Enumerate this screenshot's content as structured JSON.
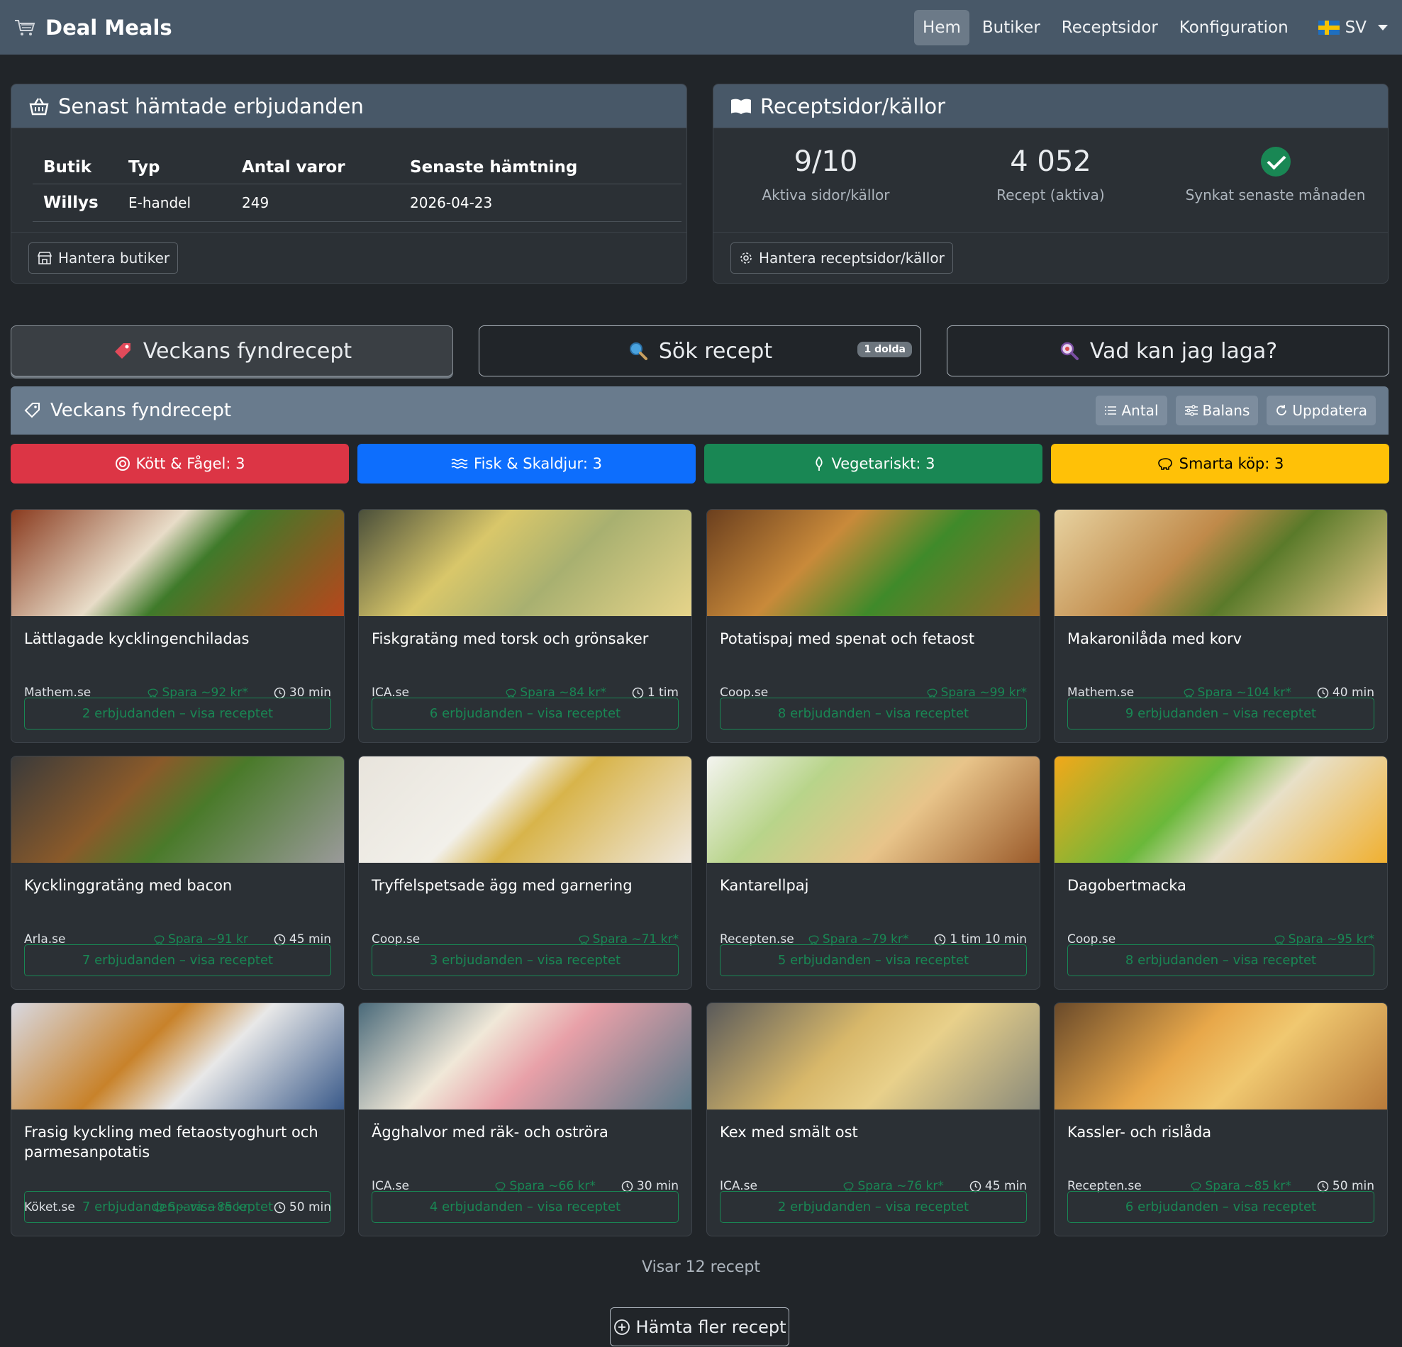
{
  "nav": {
    "brand": "Deal Meals",
    "links": [
      "Hem",
      "Butiker",
      "Receptsidor",
      "Konfiguration"
    ],
    "lang": "SV"
  },
  "offers": {
    "title": "Senast hämtade erbjudanden",
    "headers": [
      "Butik",
      "Typ",
      "Antal varor",
      "Senaste hämtning"
    ],
    "rows": [
      [
        "Willys",
        "E-handel",
        "249",
        "2026-04-23"
      ]
    ],
    "manage": "Hantera butiker"
  },
  "sources": {
    "title": "Receptsidor/källor",
    "active_value": "9/10",
    "active_label": "Aktiva sidor/källor",
    "recipes_value": "4 052",
    "recipes_label": "Recept (aktiva)",
    "sync_label": "Synkat senaste månaden",
    "manage": "Hantera receptsidor/källor"
  },
  "tabs": {
    "deals": "Veckans fyndrecept",
    "search": "Sök recept",
    "search_badge": "1 dolda",
    "cook": "Vad kan jag laga?"
  },
  "deals": {
    "title": "Veckans fyndrecept",
    "btn_count": "Antal",
    "btn_balance": "Balans",
    "btn_update": "Uppdatera"
  },
  "categories": [
    {
      "label": "Kött & Fågel: 3",
      "color": "#dc3545",
      "text": "#ffffff"
    },
    {
      "label": "Fisk & Skaldjur: 3",
      "color": "#0d6efd",
      "text": "#ffffff"
    },
    {
      "label": "Vegetariskt: 3",
      "color": "#198754",
      "text": "#ffffff"
    },
    {
      "label": "Smarta köp: 3",
      "color": "#ffc107",
      "text": "#000000"
    }
  ],
  "recipes": [
    {
      "title": "Lättlagade kycklingenchiladas",
      "source": "Mathem.se",
      "save": "Spara ~92 kr*",
      "time": "30 min",
      "offers": "2 erbjudanden – visa receptet"
    },
    {
      "title": "Fiskgratäng med torsk och grönsaker",
      "source": "ICA.se",
      "save": "Spara ~84 kr*",
      "time": "1 tim",
      "offers": "6 erbjudanden – visa receptet"
    },
    {
      "title": "Potatispaj med spenat och fetaost",
      "source": "Coop.se",
      "save": "Spara ~99 kr*",
      "time": "",
      "offers": "8 erbjudanden – visa receptet"
    },
    {
      "title": "Makaronilåda med korv",
      "source": "Mathem.se",
      "save": "Spara ~104 kr*",
      "time": "40 min",
      "offers": "9 erbjudanden – visa receptet"
    },
    {
      "title": "Kycklinggratäng med bacon",
      "source": "Arla.se",
      "save": "Spara ~91 kr",
      "time": "45 min",
      "offers": "7 erbjudanden – visa receptet"
    },
    {
      "title": "Tryffelspetsade ägg med garnering",
      "source": "Coop.se",
      "save": "Spara ~71 kr*",
      "time": "",
      "offers": "3 erbjudanden – visa receptet"
    },
    {
      "title": "Kantarellpaj",
      "source": "Recepten.se",
      "save": "Spara ~79 kr*",
      "time": "1 tim 10 min",
      "offers": "5 erbjudanden – visa receptet"
    },
    {
      "title": "Dagobertmacka",
      "source": "Coop.se",
      "save": "Spara ~95 kr*",
      "time": "",
      "offers": "8 erbjudanden – visa receptet"
    },
    {
      "title": "Frasig kyckling med fetaostyoghurt och parmesanpotatis",
      "source": "Köket.se",
      "save": "Spara ~85 kr",
      "time": "50 min",
      "offers": "7 erbjudanden – visa receptet"
    },
    {
      "title": "Ägghalvor med räk- och oströra",
      "source": "ICA.se",
      "save": "Spara ~66 kr*",
      "time": "30 min",
      "offers": "4 erbjudanden – visa receptet"
    },
    {
      "title": "Kex med smält ost",
      "source": "ICA.se",
      "save": "Spara ~76 kr*",
      "time": "45 min",
      "offers": "2 erbjudanden – visa receptet"
    },
    {
      "title": "Kassler- och rislåda",
      "source": "Recepten.se",
      "save": "Spara ~85 kr*",
      "time": "50 min",
      "offers": "6 erbjudanden – visa receptet"
    }
  ],
  "footer": {
    "showing": "Visar 12 recept",
    "more": "Hämta fler recept"
  }
}
